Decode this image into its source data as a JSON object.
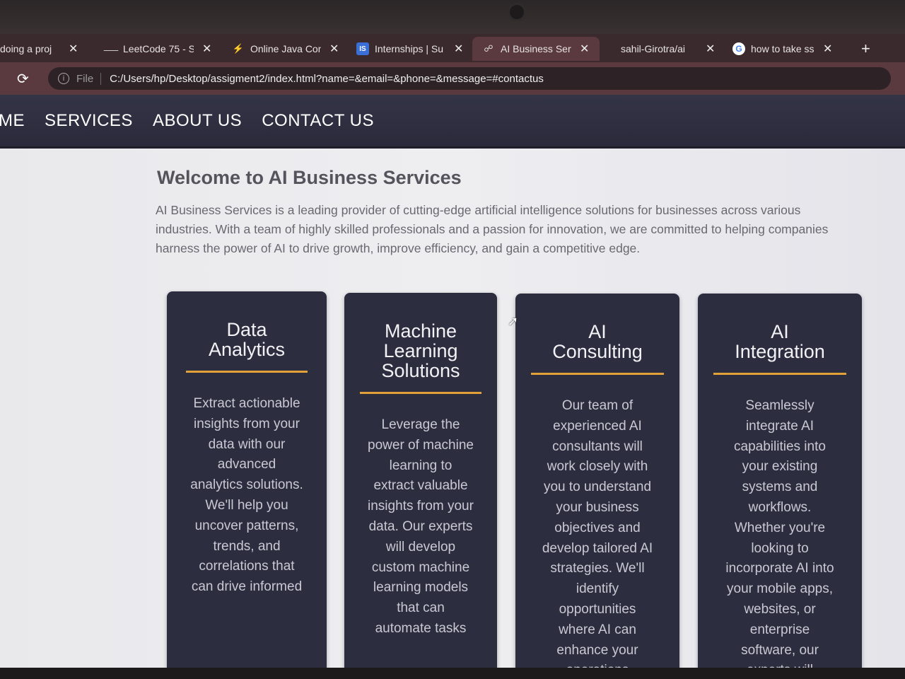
{
  "browser": {
    "tabs": [
      {
        "icon": "generic-icon",
        "title": "doing a proj",
        "active": false
      },
      {
        "icon": "leetcode-icon",
        "title": "LeetCode 75 - S",
        "active": false
      },
      {
        "icon": "bolt-icon",
        "title": "Online Java Con",
        "active": false
      },
      {
        "icon": "internshala-icon",
        "title": "Internships | Su",
        "active": false
      },
      {
        "icon": "globe-icon",
        "title": "AI Business Serv",
        "active": true
      },
      {
        "icon": "github-icon",
        "title": "sahil-Girotra/ai",
        "active": false
      },
      {
        "icon": "google-icon",
        "title": "how to take ss",
        "active": false
      }
    ],
    "file_label": "File",
    "url": "C:/Users/hp/Desktop/assigment2/index.html?name=&email=&phone=&message=#contactus"
  },
  "nav": {
    "items": [
      "ME",
      "SERVICES",
      "ABOUT US",
      "CONTACT US"
    ]
  },
  "intro": {
    "title": "Welcome to AI Business Services",
    "text": "AI Business Services is a leading provider of cutting-edge artificial intelligence solutions for businesses across various industries. With a team of highly skilled professionals and a passion for innovation, we are committed to helping companies harness the power of AI to drive growth, improve efficiency, and gain a competitive edge."
  },
  "services": [
    {
      "title": "Data Analytics",
      "text": "Extract actionable insights from your data with our advanced analytics solutions. We'll help you uncover patterns, trends, and correlations that can drive informed"
    },
    {
      "title": "Machine Learning Solutions",
      "text": "Leverage the power of machine learning to extract valuable insights from your data. Our experts will develop custom machine learning models that can automate tasks"
    },
    {
      "title": "AI Consulting",
      "text": "Our team of experienced AI consultants will work closely with you to understand your business objectives and develop tailored AI strategies. We'll identify opportunities where AI can enhance your operations"
    },
    {
      "title": "AI Integration",
      "text": "Seamlessly integrate AI capabilities into your existing systems and workflows. Whether you're looking to incorporate AI into your mobile apps, websites, or enterprise software, our experts will"
    }
  ],
  "colors": {
    "nav_bg": "#2a2a3b",
    "card_bg": "#2c2e40",
    "accent_rule": "#e2a038",
    "page_bg": "#eeeef1"
  }
}
